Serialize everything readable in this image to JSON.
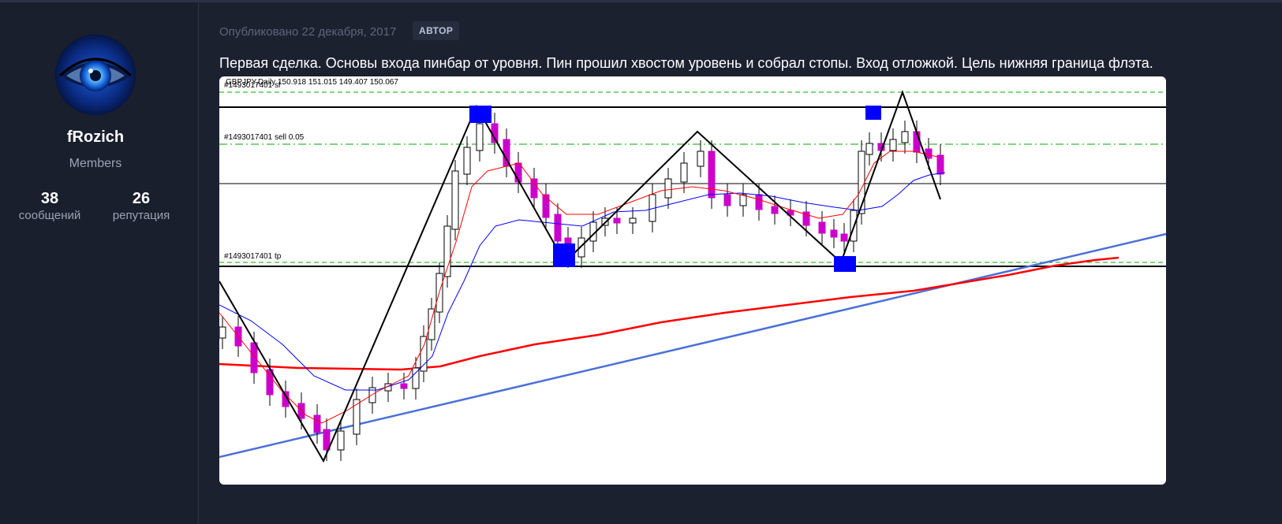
{
  "author": {
    "name": "fRozich",
    "group": "Members",
    "stats": [
      {
        "value": "38",
        "label": "сообщений"
      },
      {
        "value": "26",
        "label": "репутация"
      }
    ]
  },
  "post": {
    "published": "Опубликовано 22 декабря, 2017",
    "badge": "АВТОР",
    "text": "Первая сделка. Основы входа пинбар от уровня. Пин прошил хвостом уровень и собрал стопы. Вход отложкой. Цель нижняя граница флэта."
  },
  "chart": {
    "header": "GBPJPY,Daily  150.918 151.015 149.407 150.067",
    "order_sl": "#1493017401 sl",
    "order_sell": "#1493017401 sell 0.05",
    "order_tp": "#1493017401 tp",
    "colors": {
      "bull": "#ffffff",
      "bear": "#cc00cc",
      "ma_fast": "#ff0000",
      "ma_mid": "#0000ff",
      "ma_slow": "#ff0000",
      "trendline": "#4a6fd8",
      "zigzag": "#000000",
      "marker": "#0000ff",
      "order_line": "#00aa00"
    }
  }
}
